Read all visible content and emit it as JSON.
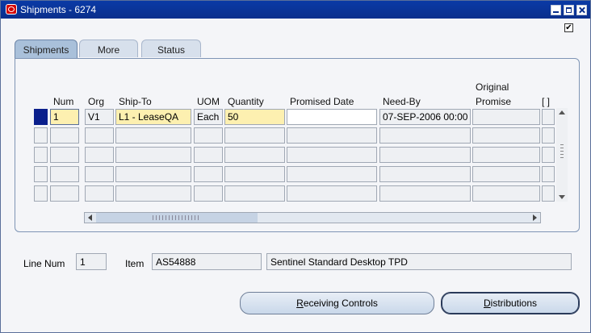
{
  "window": {
    "title": "Shipments - 6274",
    "checkbox": "✔"
  },
  "tabs": [
    {
      "label": "Shipments"
    },
    {
      "label": "More"
    },
    {
      "label": "Status"
    }
  ],
  "table": {
    "headers": {
      "num": "Num",
      "org": "Org",
      "ship_to": "Ship-To",
      "uom": "UOM",
      "quantity": "Quantity",
      "promised_date": "Promised Date",
      "need_by": "Need-By",
      "original_promise_1": "Original",
      "original_promise_2": "Promise",
      "folder": "[ ]"
    },
    "rows": [
      {
        "num": "1",
        "org": "V1",
        "ship_to": "L1 - LeaseQA",
        "uom": "Each",
        "quantity": "50",
        "promised_date": "",
        "need_by": "07-SEP-2006 00:00",
        "original_promise": ""
      }
    ]
  },
  "line_num": {
    "label": "Line Num",
    "value": "1"
  },
  "item": {
    "label": "Item",
    "code": "AS54888",
    "description": "Sentinel Standard Desktop TPD"
  },
  "buttons": {
    "receiving_controls_first": "R",
    "receiving_controls_rest": "eceiving Controls",
    "distributions_first": "D",
    "distributions_rest": "istributions"
  },
  "colors": {
    "title_bar": "#0a2f8c",
    "required_field": "#fdf0b0",
    "current_row": "#0a1f8c"
  }
}
